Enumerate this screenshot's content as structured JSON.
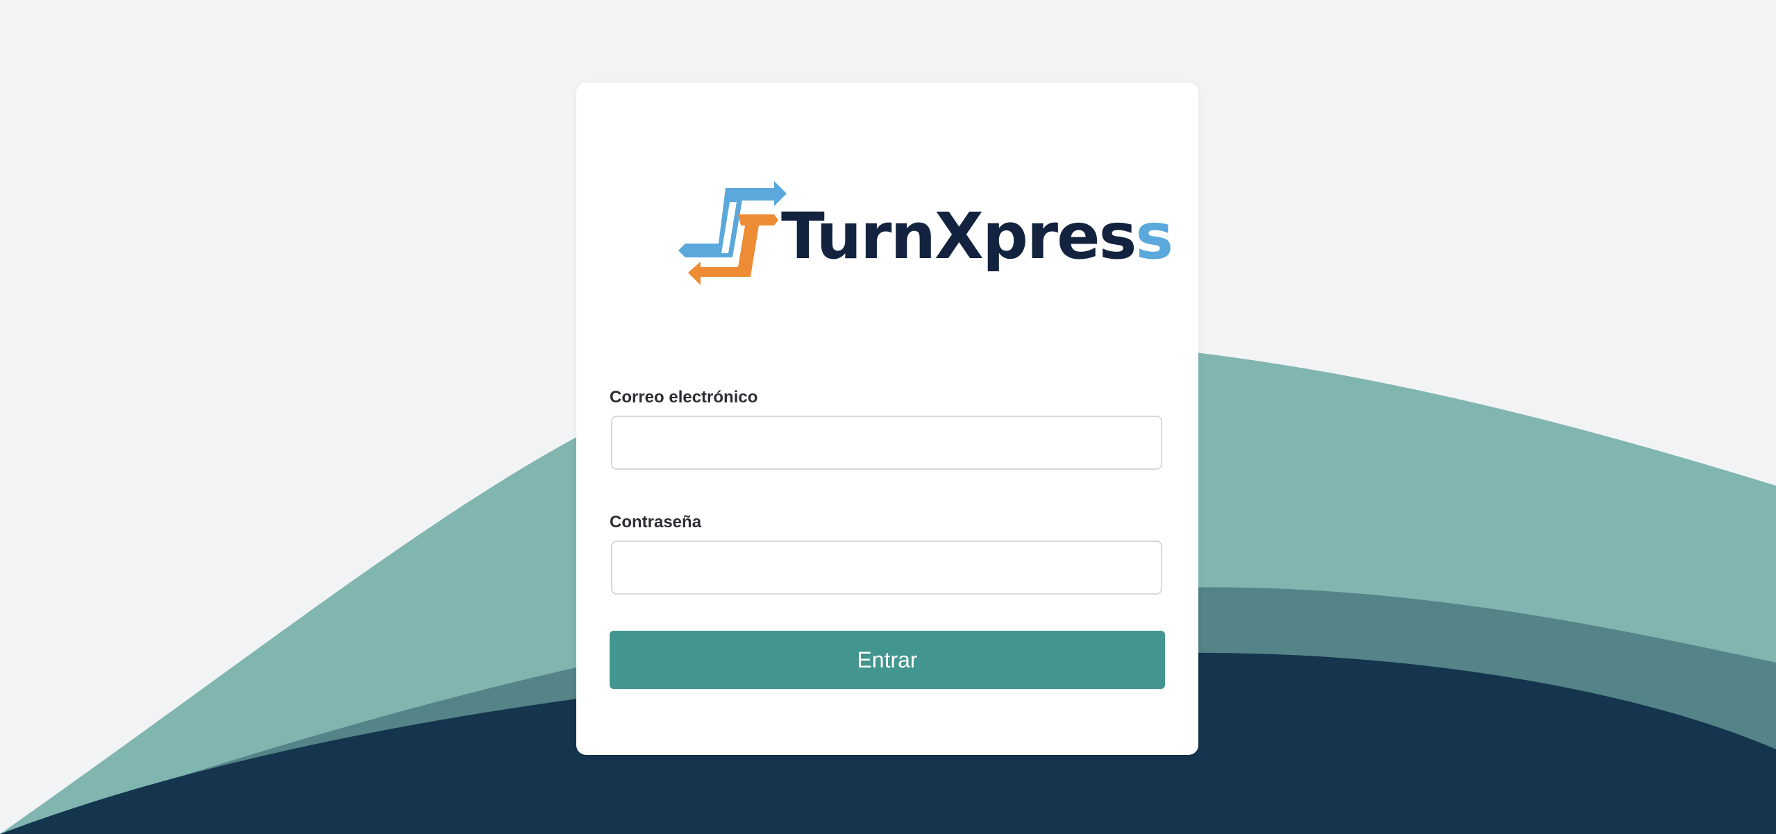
{
  "brand": {
    "name_main": "TurnXpres",
    "name_accent": "s",
    "colors": {
      "navy": "#13233f",
      "blue": "#5aa8dc",
      "orange": "#ee8c35",
      "teal": "#43968f"
    }
  },
  "login": {
    "email_label": "Correo electrónico",
    "email_value": "",
    "email_placeholder": "",
    "password_label": "Contraseña",
    "password_value": "",
    "password_placeholder": "",
    "submit_label": "Entrar"
  },
  "background": {
    "colors": [
      "#f2f3f5",
      "#80b5b0",
      "#548487",
      "#15344d"
    ]
  }
}
